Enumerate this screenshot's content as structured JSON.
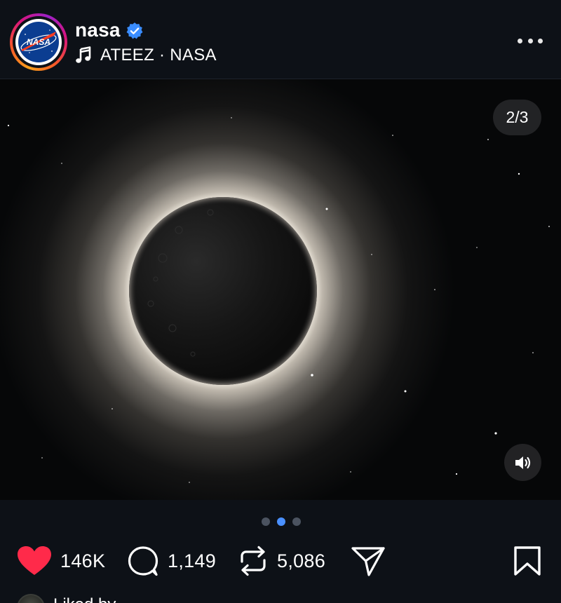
{
  "post": {
    "username": "nasa",
    "verified": true,
    "music": "ATEEZ · NASA",
    "avatar_logo_text": "NASA",
    "media_counter": "2/3",
    "carousel": {
      "total": 3,
      "active_index": 1
    },
    "stats": {
      "likes": "146K",
      "comments": "1,149",
      "reposts": "5,086"
    },
    "liked": true,
    "liked_by_text": "Liked by"
  },
  "colors": {
    "background": "#0d1117",
    "like_red": "#ff2a4a",
    "verified_blue": "#3a8dff",
    "active_dot": "#4a90ff"
  },
  "icons": {
    "more": "more-horizontal-icon",
    "music": "music-note-icon",
    "mute": "speaker-icon",
    "like": "heart-filled-icon",
    "comment": "speech-bubble-icon",
    "repost": "repost-arrows-icon",
    "share": "paper-plane-icon",
    "save": "bookmark-icon"
  }
}
